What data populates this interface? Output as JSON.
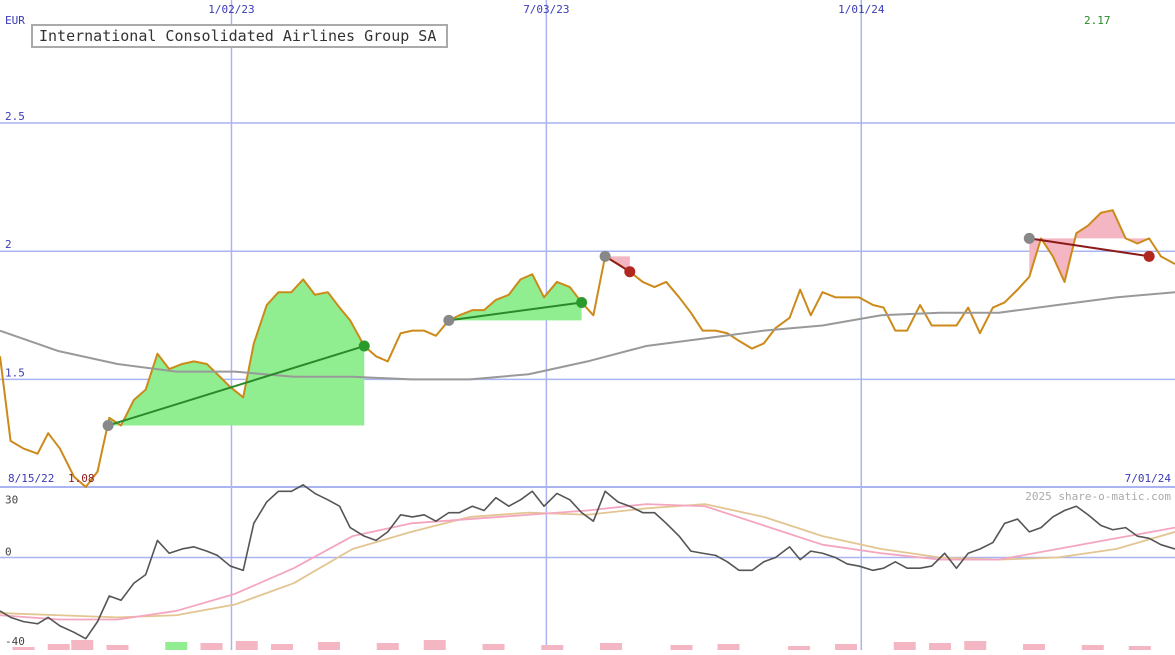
{
  "title": "International Consolidated Airlines Group SA",
  "credit": "2025 share-o-matic.com",
  "colors": {
    "price": "#cc8a1a",
    "sma": "#999999",
    "gain_fill": "#90ee90",
    "loss_fill": "#f4b6c2",
    "gain_line": "#2a8a2a",
    "loss_line": "#8b1a1a",
    "grid": "#aab4f0",
    "osc_main": "#555555",
    "osc_fast": "#f4a6c0",
    "osc_slow": "#e3c592",
    "volume": "#f4b6c2"
  },
  "chart_data": [
    {
      "type": "line",
      "name": "price-panel",
      "ylabel": "EUR",
      "ylim": [
        1.08,
        2.98
      ],
      "y_ticks": [
        1.5,
        2,
        2.5
      ],
      "y_tick_labels": [
        "1.5",
        "2",
        "2.5"
      ],
      "x_range": [
        0,
        1
      ],
      "x_date_labels": [
        {
          "x": 0.197,
          "label": "1/02/23"
        },
        {
          "x": 0.465,
          "label": "7/03/23"
        },
        {
          "x": 0.733,
          "label": "1/01/24"
        }
      ],
      "start_label": "8/15/22",
      "end_label": "7/01/24",
      "min_label": "1.08",
      "max_label": "2.17",
      "series": [
        {
          "role": "price",
          "x": [
            0,
            0.009,
            0.02,
            0.032,
            0.041,
            0.051,
            0.063,
            0.073,
            0.083,
            0.093,
            0.103,
            0.114,
            0.124,
            0.134,
            0.144,
            0.155,
            0.165,
            0.176,
            0.185,
            0.196,
            0.207,
            0.216,
            0.227,
            0.237,
            0.248,
            0.258,
            0.268,
            0.279,
            0.289,
            0.298,
            0.31,
            0.32,
            0.33,
            0.341,
            0.351,
            0.361,
            0.371,
            0.382,
            0.391,
            0.402,
            0.412,
            0.422,
            0.433,
            0.443,
            0.453,
            0.463,
            0.474,
            0.485,
            0.495,
            0.505,
            0.515,
            0.526,
            0.536,
            0.547,
            0.557,
            0.567,
            0.578,
            0.588,
            0.598,
            0.609,
            0.619,
            0.629,
            0.64,
            0.65,
            0.66,
            0.672,
            0.681,
            0.69,
            0.7,
            0.711,
            0.721,
            0.731,
            0.743,
            0.752,
            0.762,
            0.772,
            0.783,
            0.793,
            0.804,
            0.814,
            0.824,
            0.834,
            0.845,
            0.855,
            0.866,
            0.876,
            0.886,
            0.896,
            0.906,
            0.916,
            0.926,
            0.937,
            0.947,
            0.958,
            0.968,
            0.978,
            0.988,
            1.0
          ],
          "values": [
            1.59,
            1.26,
            1.23,
            1.21,
            1.29,
            1.23,
            1.12,
            1.08,
            1.14,
            1.35,
            1.32,
            1.42,
            1.46,
            1.6,
            1.54,
            1.56,
            1.57,
            1.56,
            1.52,
            1.47,
            1.43,
            1.64,
            1.79,
            1.84,
            1.84,
            1.89,
            1.83,
            1.84,
            1.78,
            1.73,
            1.63,
            1.59,
            1.57,
            1.68,
            1.69,
            1.69,
            1.67,
            1.73,
            1.75,
            1.77,
            1.77,
            1.81,
            1.83,
            1.89,
            1.91,
            1.82,
            1.88,
            1.86,
            1.8,
            1.75,
            1.98,
            1.95,
            1.92,
            1.88,
            1.86,
            1.88,
            1.82,
            1.76,
            1.69,
            1.69,
            1.68,
            1.65,
            1.62,
            1.64,
            1.7,
            1.74,
            1.85,
            1.75,
            1.84,
            1.82,
            1.82,
            1.82,
            1.79,
            1.78,
            1.69,
            1.69,
            1.79,
            1.71,
            1.71,
            1.71,
            1.78,
            1.68,
            1.78,
            1.8,
            1.85,
            1.9,
            2.05,
            1.98,
            1.88,
            2.07,
            2.1,
            2.15,
            2.16,
            2.05,
            2.03,
            2.05,
            1.98,
            1.95
          ]
        },
        {
          "role": "moving-average",
          "x": [
            0,
            0.05,
            0.1,
            0.15,
            0.2,
            0.25,
            0.3,
            0.35,
            0.4,
            0.45,
            0.5,
            0.55,
            0.6,
            0.65,
            0.7,
            0.75,
            0.8,
            0.85,
            0.9,
            0.95,
            1.0
          ],
          "values": [
            1.69,
            1.61,
            1.56,
            1.53,
            1.53,
            1.51,
            1.51,
            1.5,
            1.5,
            1.52,
            1.57,
            1.63,
            1.66,
            1.69,
            1.71,
            1.75,
            1.76,
            1.76,
            1.79,
            1.82,
            1.84
          ]
        }
      ],
      "annotations": [
        {
          "kind": "gain",
          "x0": 0.092,
          "y0": 1.32,
          "x1": 0.31,
          "y1": 1.63
        },
        {
          "kind": "gain",
          "x0": 0.382,
          "y0": 1.73,
          "x1": 0.495,
          "y1": 1.8
        },
        {
          "kind": "loss",
          "x0": 0.515,
          "y0": 1.98,
          "x1": 0.536,
          "y1": 1.92
        },
        {
          "kind": "loss",
          "x0": 0.876,
          "y0": 2.05,
          "x1": 0.978,
          "y1": 1.98
        }
      ]
    },
    {
      "type": "line",
      "name": "oscillator-panel",
      "ylim": [
        -40,
        33
      ],
      "y_ticks": [
        -40,
        0,
        30
      ],
      "y_tick_labels": [
        "-40",
        "0",
        "30"
      ],
      "series": [
        {
          "role": "oscillator",
          "x": [
            0,
            0.009,
            0.02,
            0.032,
            0.041,
            0.051,
            0.063,
            0.073,
            0.083,
            0.093,
            0.103,
            0.114,
            0.124,
            0.134,
            0.144,
            0.155,
            0.165,
            0.176,
            0.185,
            0.196,
            0.207,
            0.216,
            0.227,
            0.237,
            0.248,
            0.258,
            0.268,
            0.279,
            0.289,
            0.298,
            0.31,
            0.32,
            0.33,
            0.341,
            0.351,
            0.361,
            0.371,
            0.382,
            0.391,
            0.402,
            0.412,
            0.422,
            0.433,
            0.443,
            0.453,
            0.463,
            0.474,
            0.485,
            0.495,
            0.505,
            0.515,
            0.526,
            0.536,
            0.547,
            0.557,
            0.567,
            0.578,
            0.588,
            0.598,
            0.609,
            0.619,
            0.629,
            0.64,
            0.65,
            0.66,
            0.672,
            0.681,
            0.69,
            0.7,
            0.711,
            0.721,
            0.731,
            0.743,
            0.752,
            0.762,
            0.772,
            0.783,
            0.793,
            0.804,
            0.814,
            0.824,
            0.834,
            0.845,
            0.855,
            0.866,
            0.876,
            0.886,
            0.896,
            0.906,
            0.916,
            0.926,
            0.937,
            0.947,
            0.958,
            0.968,
            0.978,
            0.988,
            1.0
          ],
          "values": [
            -25,
            -28,
            -30,
            -31,
            -28,
            -32,
            -35,
            -38,
            -30,
            -18,
            -20,
            -12,
            -8,
            8,
            2,
            4,
            5,
            3,
            1,
            -4,
            -6,
            16,
            26,
            31,
            31,
            34,
            30,
            27,
            24,
            14,
            10,
            8,
            12,
            20,
            19,
            20,
            17,
            21,
            21,
            24,
            22,
            28,
            24,
            27,
            31,
            24,
            30,
            27,
            21,
            17,
            31,
            26,
            24,
            21,
            21,
            16,
            10,
            3,
            2,
            1,
            -2,
            -6,
            -6,
            -2,
            0,
            5,
            -1,
            3,
            2,
            0,
            -3,
            -4,
            -6,
            -5,
            -2,
            -5,
            -5,
            -4,
            2,
            -5,
            2,
            4,
            7,
            16,
            18,
            12,
            14,
            19,
            22,
            24,
            20,
            15,
            13,
            14,
            10,
            9,
            6,
            4
          ]
        },
        {
          "role": "fast-average",
          "x": [
            0,
            0.05,
            0.1,
            0.15,
            0.2,
            0.25,
            0.3,
            0.35,
            0.4,
            0.45,
            0.5,
            0.55,
            0.6,
            0.65,
            0.7,
            0.75,
            0.8,
            0.85,
            0.9,
            0.95,
            1.0
          ],
          "values": [
            -27,
            -29,
            -29,
            -25,
            -17,
            -5,
            10,
            16,
            18,
            20,
            22,
            25,
            24,
            15,
            6,
            2,
            -1,
            -1,
            4,
            9,
            14
          ]
        },
        {
          "role": "slow-average",
          "x": [
            0,
            0.05,
            0.1,
            0.15,
            0.2,
            0.25,
            0.3,
            0.35,
            0.4,
            0.45,
            0.5,
            0.55,
            0.6,
            0.65,
            0.7,
            0.75,
            0.8,
            0.85,
            0.9,
            0.95,
            1.0
          ],
          "values": [
            -26,
            -27,
            -28,
            -27,
            -22,
            -12,
            4,
            12,
            19,
            21,
            20,
            23,
            25,
            19,
            10,
            4,
            0,
            -1,
            0,
            4,
            12
          ]
        }
      ]
    },
    {
      "type": "bar",
      "name": "volume-strip",
      "x": [
        0.02,
        0.05,
        0.07,
        0.1,
        0.15,
        0.18,
        0.21,
        0.24,
        0.28,
        0.33,
        0.37,
        0.42,
        0.47,
        0.52,
        0.58,
        0.62,
        0.68,
        0.72,
        0.77,
        0.8,
        0.83,
        0.88,
        0.93,
        0.97
      ],
      "values": [
        0.3,
        0.6,
        1.0,
        0.5,
        0.8,
        0.7,
        0.9,
        0.6,
        0.8,
        0.7,
        1.0,
        0.6,
        0.5,
        0.7,
        0.5,
        0.6,
        0.4,
        0.6,
        0.8,
        0.7,
        0.9,
        0.6,
        0.5,
        0.4
      ],
      "highlight_x": [
        0.15
      ]
    }
  ]
}
